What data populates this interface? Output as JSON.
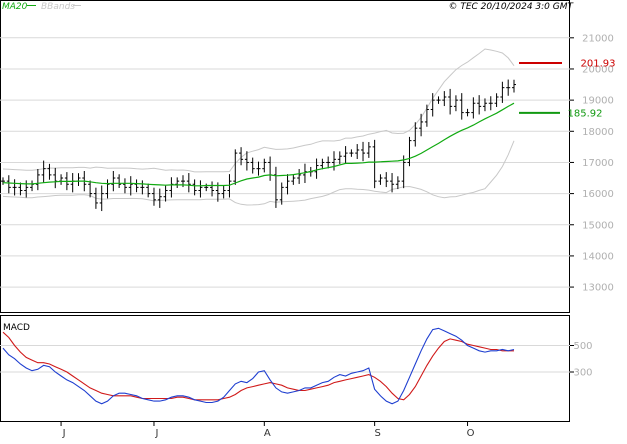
{
  "header": {
    "legend_ma": "MA20",
    "legend_bb": "BBands",
    "source_stamp": "© TEC 20/10/2024 3:0 GMT"
  },
  "colors": {
    "price_bar": "#000000",
    "ma20": "#11aa11",
    "bbands": "#c8c8c8",
    "grid": "#d9d9d9",
    "resistance": "#cc0000",
    "support": "#119911",
    "macd_line": "#1f3fd0",
    "signal_line": "#d01a1a",
    "axis_label": "#b0b0b0"
  },
  "price_axis": {
    "ticks": [
      130,
      140,
      150,
      160,
      170,
      180,
      190,
      200,
      210
    ],
    "tick_labels": [
      "13000",
      "14000",
      "15000",
      "16000",
      "17000",
      "18000",
      "19000",
      "20000",
      "21000"
    ],
    "ylim": [
      122,
      217
    ]
  },
  "macd_axis": {
    "ticks": [
      3,
      5
    ],
    "tick_labels": [
      "300",
      "500"
    ],
    "ylim": [
      -0.7,
      7.0
    ],
    "title": "MACD"
  },
  "x_axis": {
    "labels": [
      "J",
      "J",
      "A",
      "S",
      "O"
    ],
    "label_index": [
      10,
      26,
      45,
      64,
      80
    ]
  },
  "levels": {
    "resistance": {
      "value": 201.93,
      "label": "201.93"
    },
    "support": {
      "value": 185.92,
      "label": "185.92"
    }
  },
  "chart_data": [
    {
      "type": "bar",
      "subtype": "ohlc",
      "title": "",
      "legend": [
        "MA20",
        "BBands"
      ],
      "n": 89,
      "close": [
        164,
        162,
        162,
        161,
        162,
        163,
        166,
        168,
        166,
        164,
        165,
        163,
        164,
        165,
        163,
        160,
        157,
        160,
        163,
        165,
        163,
        162,
        163,
        162,
        162,
        160,
        158,
        159,
        161,
        163,
        164,
        164,
        163,
        161,
        162,
        162,
        161,
        160,
        161,
        164,
        173,
        171,
        170,
        168,
        168,
        170,
        166,
        158,
        162,
        164,
        165,
        166,
        167,
        167,
        169,
        170,
        170,
        171,
        172,
        173,
        173,
        174,
        173,
        175,
        164,
        165,
        164,
        163,
        164,
        170,
        177,
        181,
        183,
        187,
        190,
        190,
        191,
        188,
        190,
        186,
        186,
        189,
        188,
        189,
        189,
        191,
        194,
        194,
        195
      ],
      "ma20": [
        163.5,
        163.4,
        163.3,
        163.2,
        163.1,
        163.1,
        163.3,
        163.5,
        163.7,
        163.8,
        163.9,
        163.9,
        163.9,
        164,
        164,
        163.8,
        163.5,
        163.3,
        163.2,
        163.3,
        163.3,
        163.3,
        163.3,
        163.2,
        163.1,
        163,
        162.9,
        162.8,
        162.7,
        162.8,
        162.8,
        162.8,
        162.7,
        162.5,
        162.5,
        162.6,
        162.6,
        162.6,
        162.6,
        162.7,
        163.4,
        164.1,
        164.7,
        165,
        165.3,
        165.8,
        166,
        165.7,
        165.8,
        165.9,
        166.1,
        166.4,
        166.7,
        167.1,
        167.6,
        168,
        168.3,
        168.7,
        169.2,
        169.7,
        169.7,
        169.8,
        169.9,
        170.1,
        170.1,
        170.2,
        170.3,
        170.4,
        170.5,
        170.8,
        171.3,
        172,
        172.9,
        174,
        175.1,
        176.1,
        177.3,
        178.4,
        179.4,
        180.3,
        181.1,
        182,
        183,
        184,
        184.9,
        185.8,
        186.9,
        188,
        189
      ]
    },
    {
      "type": "line",
      "title": "MACD",
      "n": 89,
      "series": [
        {
          "name": "",
          "values": [
            4.8,
            4.3,
            4.0,
            3.6,
            3.3,
            3.1,
            3.2,
            3.5,
            3.4,
            3.0,
            2.7,
            2.4,
            2.2,
            1.9,
            1.6,
            1.2,
            0.8,
            0.6,
            0.8,
            1.2,
            1.4,
            1.4,
            1.3,
            1.2,
            1.0,
            0.9,
            0.8,
            0.8,
            0.9,
            1.1,
            1.2,
            1.2,
            1.1,
            0.9,
            0.8,
            0.7,
            0.7,
            0.8,
            1.1,
            1.6,
            2.1,
            2.3,
            2.2,
            2.5,
            3.0,
            3.1,
            2.4,
            1.8,
            1.5,
            1.4,
            1.5,
            1.6,
            1.8,
            1.8,
            2.0,
            2.2,
            2.3,
            2.6,
            2.8,
            2.7,
            2.9,
            3.0,
            3.1,
            3.3,
            1.7,
            1.2,
            0.8,
            0.6,
            0.8,
            1.6,
            2.6,
            3.6,
            4.6,
            5.5,
            6.2,
            6.3,
            6.1,
            5.9,
            5.7,
            5.4,
            5.0,
            4.8,
            4.6,
            4.5,
            4.6,
            4.6,
            4.7,
            4.6,
            4.7
          ]
        },
        {
          "name": "",
          "values": [
            6.0,
            5.6,
            5.0,
            4.5,
            4.1,
            3.9,
            3.7,
            3.7,
            3.6,
            3.4,
            3.2,
            3.0,
            2.7,
            2.4,
            2.1,
            1.8,
            1.6,
            1.4,
            1.3,
            1.2,
            1.2,
            1.2,
            1.2,
            1.1,
            1.0,
            1.0,
            1.0,
            1.0,
            1.0,
            1.0,
            1.1,
            1.1,
            1.0,
            0.9,
            0.9,
            0.9,
            0.9,
            0.9,
            1.0,
            1.1,
            1.3,
            1.6,
            1.8,
            1.9,
            2.0,
            2.1,
            2.2,
            2.1,
            2.0,
            1.8,
            1.7,
            1.6,
            1.6,
            1.7,
            1.8,
            1.9,
            2.0,
            2.2,
            2.3,
            2.4,
            2.5,
            2.6,
            2.7,
            2.8,
            2.6,
            2.3,
            1.9,
            1.4,
            1.0,
            0.9,
            1.3,
            1.9,
            2.7,
            3.5,
            4.2,
            4.8,
            5.3,
            5.5,
            5.4,
            5.3,
            5.1,
            5.0,
            4.9,
            4.8,
            4.7,
            4.7,
            4.6,
            4.6,
            4.6
          ]
        }
      ]
    }
  ]
}
